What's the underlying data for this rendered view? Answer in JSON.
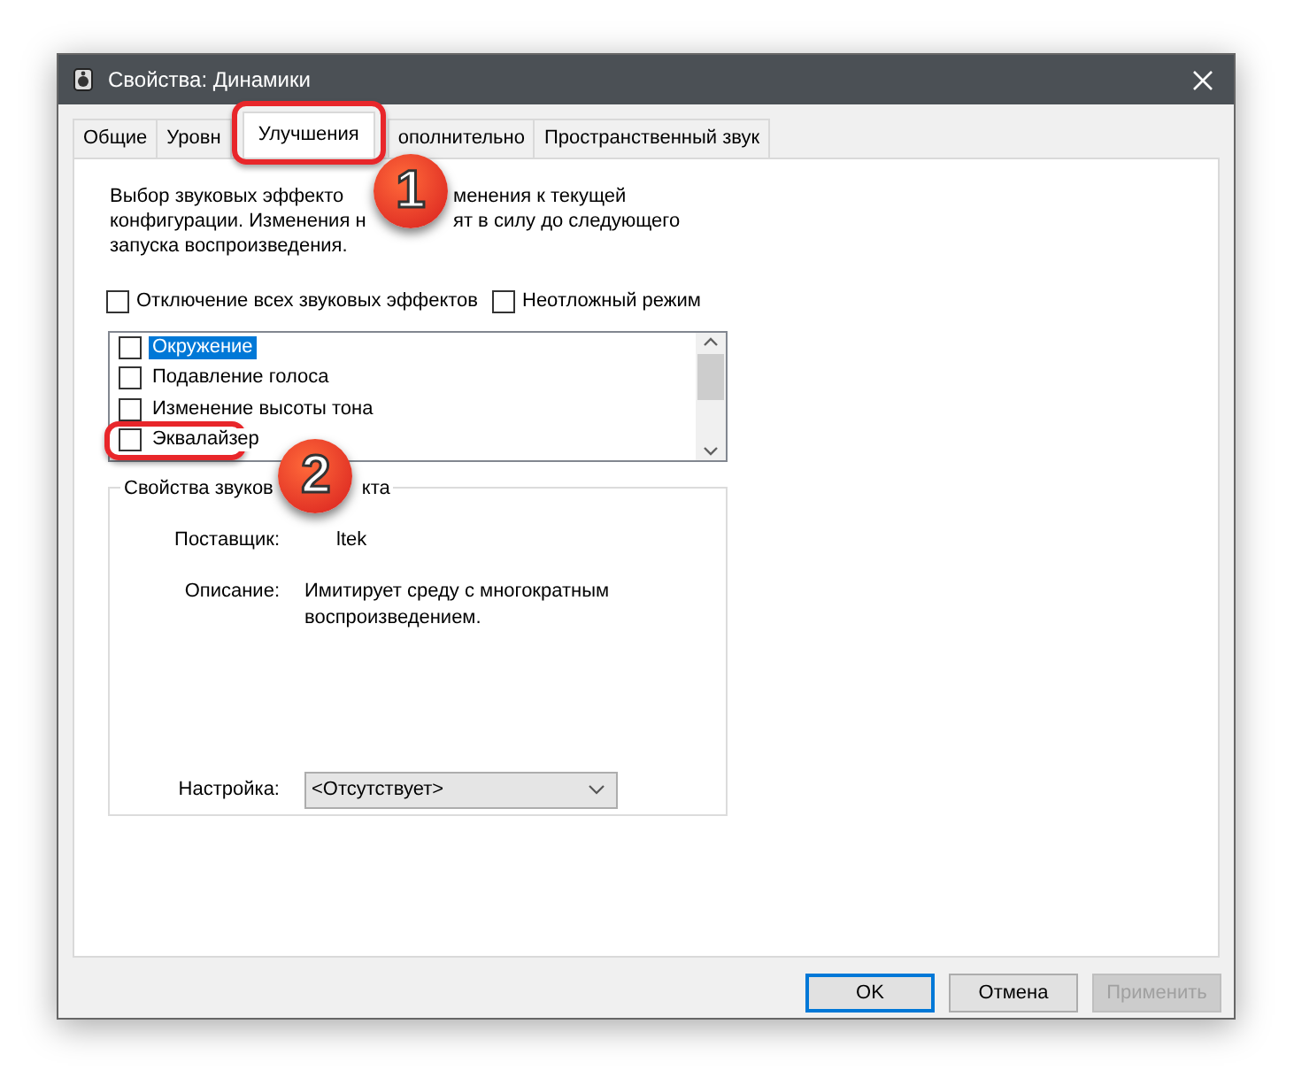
{
  "window": {
    "title": "Свойства: Динамики"
  },
  "tabs": [
    {
      "label": "Общие",
      "selected": false
    },
    {
      "label": "Уровн",
      "selected": false
    },
    {
      "label": "Улучшения",
      "selected": true
    },
    {
      "label": "ополнительно",
      "selected": false
    },
    {
      "label": "Пространственный звук",
      "selected": false
    }
  ],
  "description": [
    [
      "Выбор звуковых эффекто",
      "менения к текущей"
    ],
    [
      "конфигурации. Изменения н",
      "ят в силу до следующего"
    ],
    [
      "запуска воспроизведения."
    ]
  ],
  "options": [
    {
      "label": "Отключение всех звуковых эффектов",
      "checked": false
    },
    {
      "label": "Неотложный режим",
      "checked": false
    }
  ],
  "effects": [
    {
      "label": "Окружение",
      "checked": false,
      "selected": true
    },
    {
      "label": "Подавление голоса",
      "checked": false,
      "selected": false
    },
    {
      "label": "Изменение высоты тона",
      "checked": false,
      "selected": false
    },
    {
      "label": "Эквалайзер",
      "checked": false,
      "selected": false
    }
  ],
  "group": {
    "legend": [
      "Свойства звуков",
      "кта"
    ],
    "provider_label": "Поставщик:",
    "provider_value": "ltek",
    "description_label": "Описание:",
    "description_value": "Имитирует среду с многократным воспроизведением.",
    "setting_label": "Настройка:",
    "setting_value": "<Отсутствует>"
  },
  "buttons": [
    {
      "label": "OK",
      "default": true,
      "disabled": false
    },
    {
      "label": "Отмена",
      "default": false,
      "disabled": false
    },
    {
      "label": "Применить",
      "default": false,
      "disabled": true
    }
  ],
  "callouts": [
    {
      "label": "1"
    },
    {
      "label": "2"
    }
  ]
}
